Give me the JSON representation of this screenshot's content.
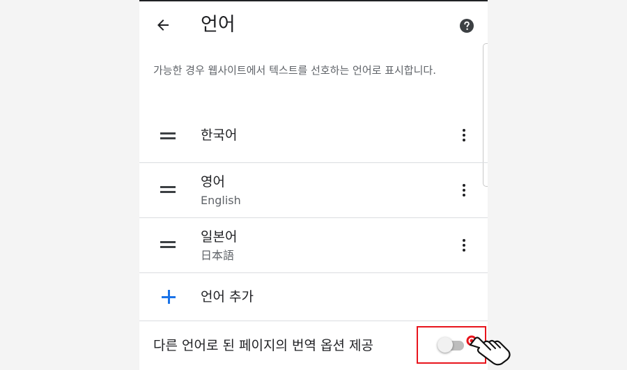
{
  "header": {
    "title": "언어",
    "back_icon": "arrow-left-icon",
    "help_icon": "help-circle-icon"
  },
  "description": "가능한 경우 웹사이트에서 텍스트를 선호하는 언어로 표시합니다.",
  "languages": [
    {
      "name": "한국어",
      "subtitle": ""
    },
    {
      "name": "영어",
      "subtitle": "English"
    },
    {
      "name": "일본어",
      "subtitle": "日本語"
    }
  ],
  "add_language": {
    "label": "언어 추가",
    "icon": "plus-icon",
    "icon_color": "#1a73e8"
  },
  "translate_option": {
    "label": "다른 언어로 된 페이지의 번역 옵션 제공",
    "enabled": false
  },
  "annotation": {
    "highlight_color": "#e8141c",
    "pointer_icon": "hand-pointer-icon"
  }
}
